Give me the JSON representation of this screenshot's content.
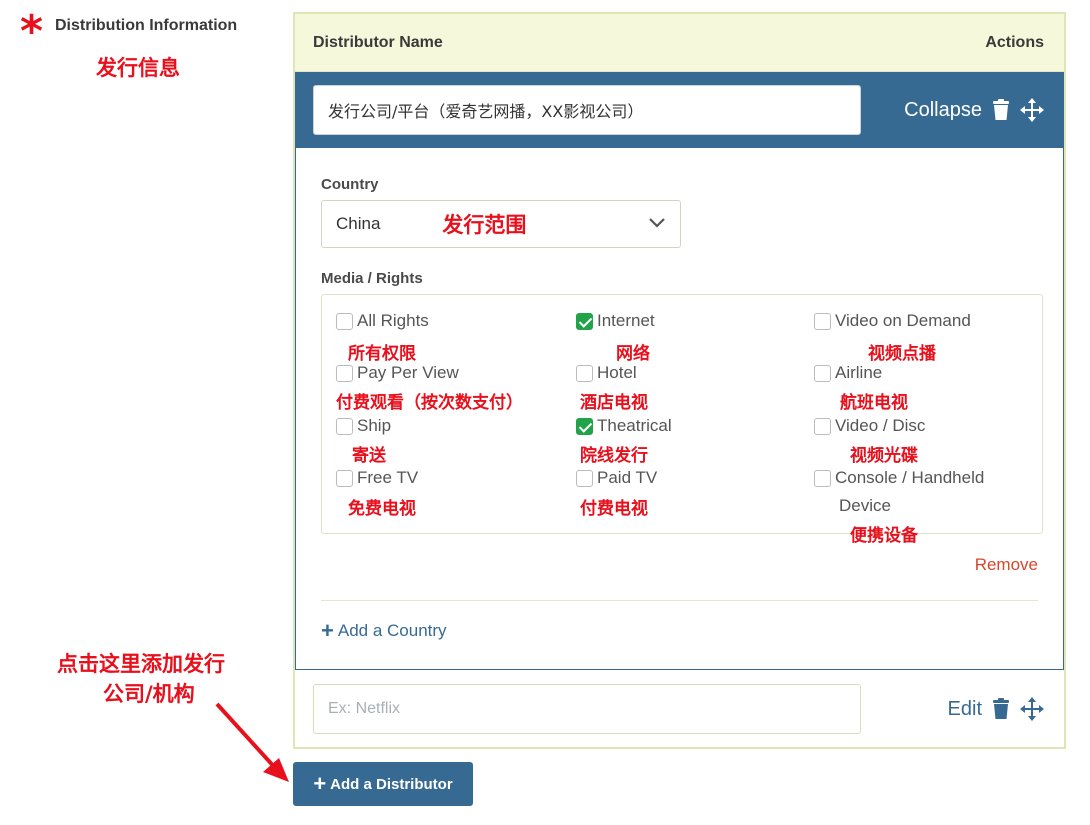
{
  "field": {
    "required_mark": "*",
    "label": "Distribution Information",
    "label_cn": "发行信息"
  },
  "table": {
    "col_name": "Distributor Name",
    "col_actions": "Actions"
  },
  "row1": {
    "name_value": "发行公司/平台（爱奇艺网播，XX影视公司）",
    "collapse_label": "Collapse",
    "country_label": "Country",
    "country_value": "China",
    "country_note_cn": "发行范围",
    "media_label": "Media / Rights",
    "remove_label": "Remove",
    "add_country_label": "Add a Country"
  },
  "rights": [
    {
      "label": "All Rights",
      "checked": false,
      "cn": "所有权限"
    },
    {
      "label": "Internet",
      "checked": true,
      "cn": "网络"
    },
    {
      "label": "Video on Demand",
      "checked": false,
      "cn": "视频点播"
    },
    {
      "label": "Pay Per View",
      "checked": false,
      "cn": "付费观看（按次数支付）"
    },
    {
      "label": "Hotel",
      "checked": false,
      "cn": "酒店电视"
    },
    {
      "label": "Airline",
      "checked": false,
      "cn": "航班电视"
    },
    {
      "label": "Ship",
      "checked": false,
      "cn": "寄送"
    },
    {
      "label": "Theatrical",
      "checked": true,
      "cn": "院线发行"
    },
    {
      "label": "Video / Disc",
      "checked": false,
      "cn": "视频光碟"
    },
    {
      "label": "Free TV",
      "checked": false,
      "cn": "免费电视"
    },
    {
      "label": "Paid TV",
      "checked": false,
      "cn": "付费电视"
    },
    {
      "label": "Console / Handheld",
      "label2": "Device",
      "checked": false,
      "cn": "便携设备"
    }
  ],
  "row2": {
    "placeholder": "Ex: Netflix",
    "edit_label": "Edit"
  },
  "add_distributor_label": "Add a Distributor",
  "annotation_add": {
    "line1": "点击这里添加发行",
    "line2": "公司/机构"
  },
  "colors": {
    "primary": "#376a93",
    "header_bg": "#f6f8dc",
    "check_green": "#22a34a",
    "annotation_red": "#e8101c",
    "remove_red": "#d9472b"
  }
}
